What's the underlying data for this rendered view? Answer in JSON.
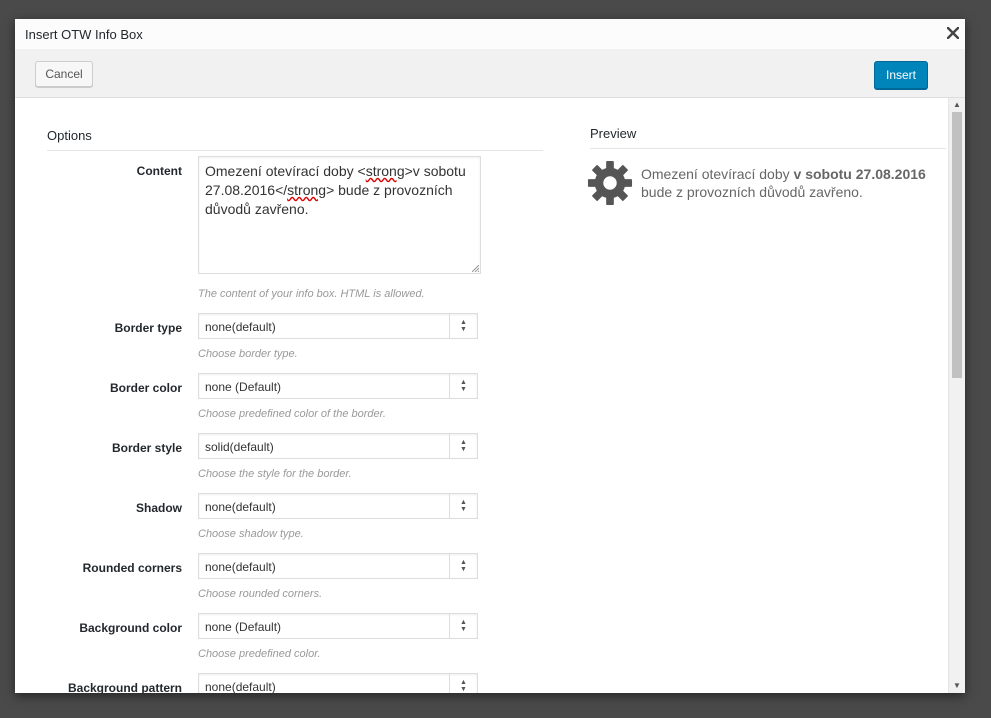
{
  "dialog": {
    "title": "Insert OTW Info Box",
    "close_glyph": "✕",
    "cancel_label": "Cancel",
    "insert_label": "Insert",
    "accent_color": "#0085ba"
  },
  "options": {
    "title": "Options",
    "content": {
      "label": "Content",
      "value_plain_1": "Omezení otevírací doby <",
      "value_tag_open": "strong",
      "value_plain_2": ">v sobotu 27.08.2016</",
      "value_tag_close": "strong",
      "value_plain_3": "> bude z provozních důvodů zavřeno.",
      "help": "The content of your info box. HTML is allowed."
    },
    "fields": [
      {
        "label": "Border type",
        "value": "none(default)",
        "help": "Choose border type."
      },
      {
        "label": "Border color",
        "value": "none (Default)",
        "help": "Choose predefined color of the border."
      },
      {
        "label": "Border style",
        "value": "solid(default)",
        "help": "Choose the style for the border."
      },
      {
        "label": "Shadow",
        "value": "none(default)",
        "help": "Choose shadow type."
      },
      {
        "label": "Rounded corners",
        "value": "none(default)",
        "help": "Choose rounded corners."
      },
      {
        "label": "Background color",
        "value": "none (Default)",
        "help": "Choose predefined color."
      },
      {
        "label": "Background pattern",
        "value": "none(default)",
        "help": ""
      }
    ]
  },
  "preview": {
    "title": "Preview",
    "icon": "gear-icon",
    "text_plain_1": "Omezení otevírací doby ",
    "text_bold": "v sobotu 27.08.2016",
    "text_plain_2": " bude z provozních důvodů zavřeno."
  }
}
